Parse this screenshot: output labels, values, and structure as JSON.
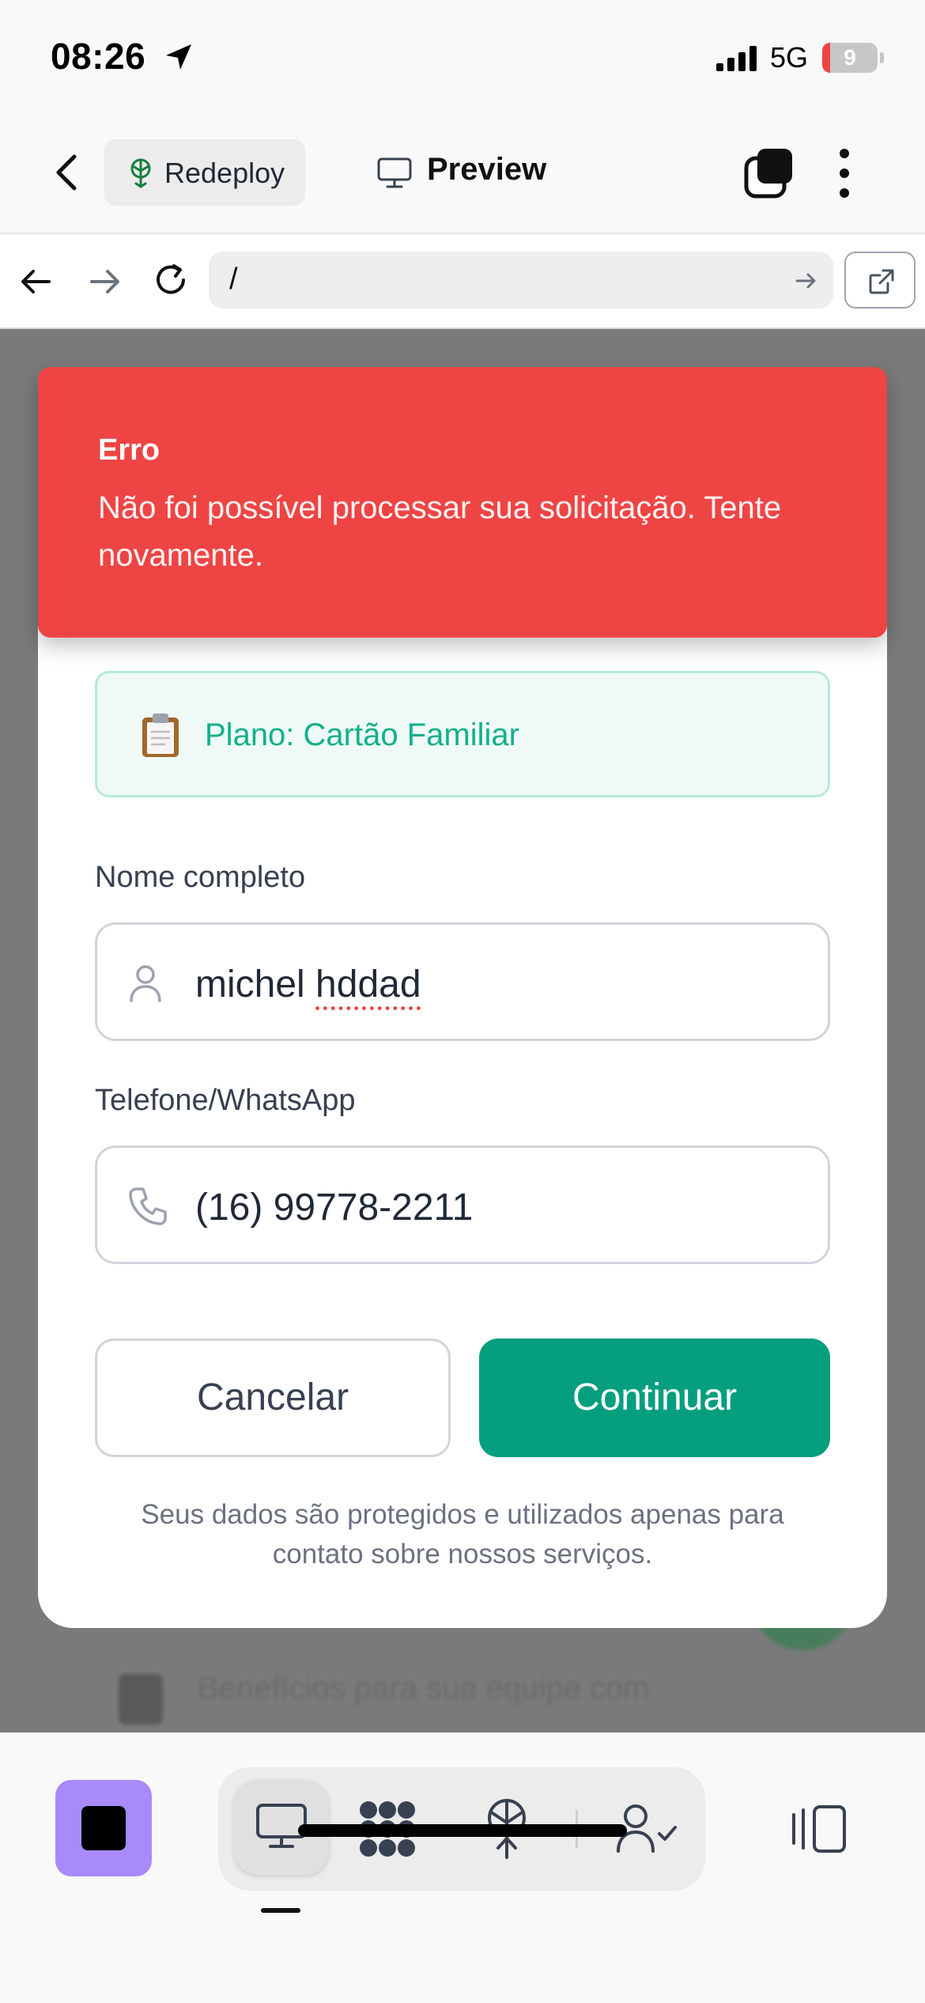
{
  "status_bar": {
    "time": "08:26",
    "network": "5G",
    "battery": "9"
  },
  "header": {
    "redeploy_label": "Redeploy",
    "preview_label": "Preview"
  },
  "url_bar": {
    "url": "/"
  },
  "toast": {
    "title": "Erro",
    "message": "Não foi possível processar sua solicitação. Tente novamente."
  },
  "form": {
    "plan_label": "Plano: Cartão Familiar",
    "name_label": "Nome completo",
    "name_first": "michel ",
    "name_second": "hddad",
    "phone_label": "Telefone/WhatsApp",
    "phone_value": "(16) 99778-2211",
    "cancel_label": "Cancelar",
    "continue_label": "Continuar",
    "privacy_note": "Seus dados são protegidos e utilizados apenas para contato sobre nossos serviços."
  },
  "background": {
    "text": "Benefícios para sua equipe com"
  },
  "colors": {
    "error": "#ef4444",
    "accent": "#059e7e",
    "stop_button": "#a78bfa"
  },
  "icons": {
    "plan": "clipboard-icon",
    "name": "user-icon",
    "phone": "phone-icon"
  }
}
